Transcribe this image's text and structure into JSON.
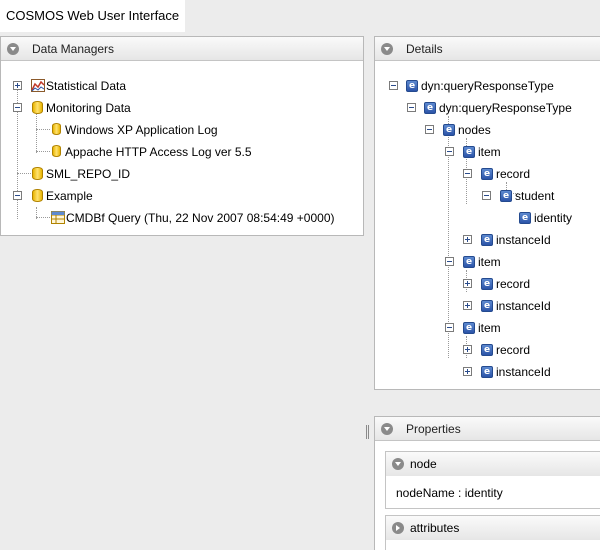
{
  "app": {
    "title": "COSMOS Web User Interface"
  },
  "data_managers": {
    "title": "Data Managers",
    "items": [
      {
        "label": "Statistical Data",
        "icon": "chart-icon"
      },
      {
        "label": "Monitoring Data",
        "icon": "database-icon"
      },
      {
        "label": "Windows XP Application Log",
        "icon": "database-icon"
      },
      {
        "label": "Appache HTTP Access Log ver 5.5",
        "icon": "database-icon"
      },
      {
        "label": "SML_REPO_ID",
        "icon": "database-icon"
      },
      {
        "label": "Example",
        "icon": "database-icon"
      },
      {
        "label": "CMDBf Query (Thu, 22 Nov 2007 08:54:49 +0000)",
        "icon": "query-icon"
      }
    ]
  },
  "details": {
    "title": "Details",
    "nodes": [
      {
        "label": "dyn:queryResponseType"
      },
      {
        "label": "dyn:queryResponseType"
      },
      {
        "label": "nodes"
      },
      {
        "label": "item"
      },
      {
        "label": "record"
      },
      {
        "label": "student"
      },
      {
        "label": "identity"
      },
      {
        "label": "instanceId"
      },
      {
        "label": "item"
      },
      {
        "label": "record"
      },
      {
        "label": "instanceId"
      },
      {
        "label": "item"
      },
      {
        "label": "record"
      },
      {
        "label": "instanceId"
      }
    ],
    "element_icon_glyph": "e"
  },
  "properties": {
    "title": "Properties",
    "node_section": {
      "title": "node",
      "value": "nodeName : identity"
    },
    "attributes_section": {
      "title": "attributes"
    }
  },
  "colors": {
    "element_icon": "#2c54a8",
    "database_icon": "#e8b400",
    "panel_header": "#e6e6e6"
  }
}
